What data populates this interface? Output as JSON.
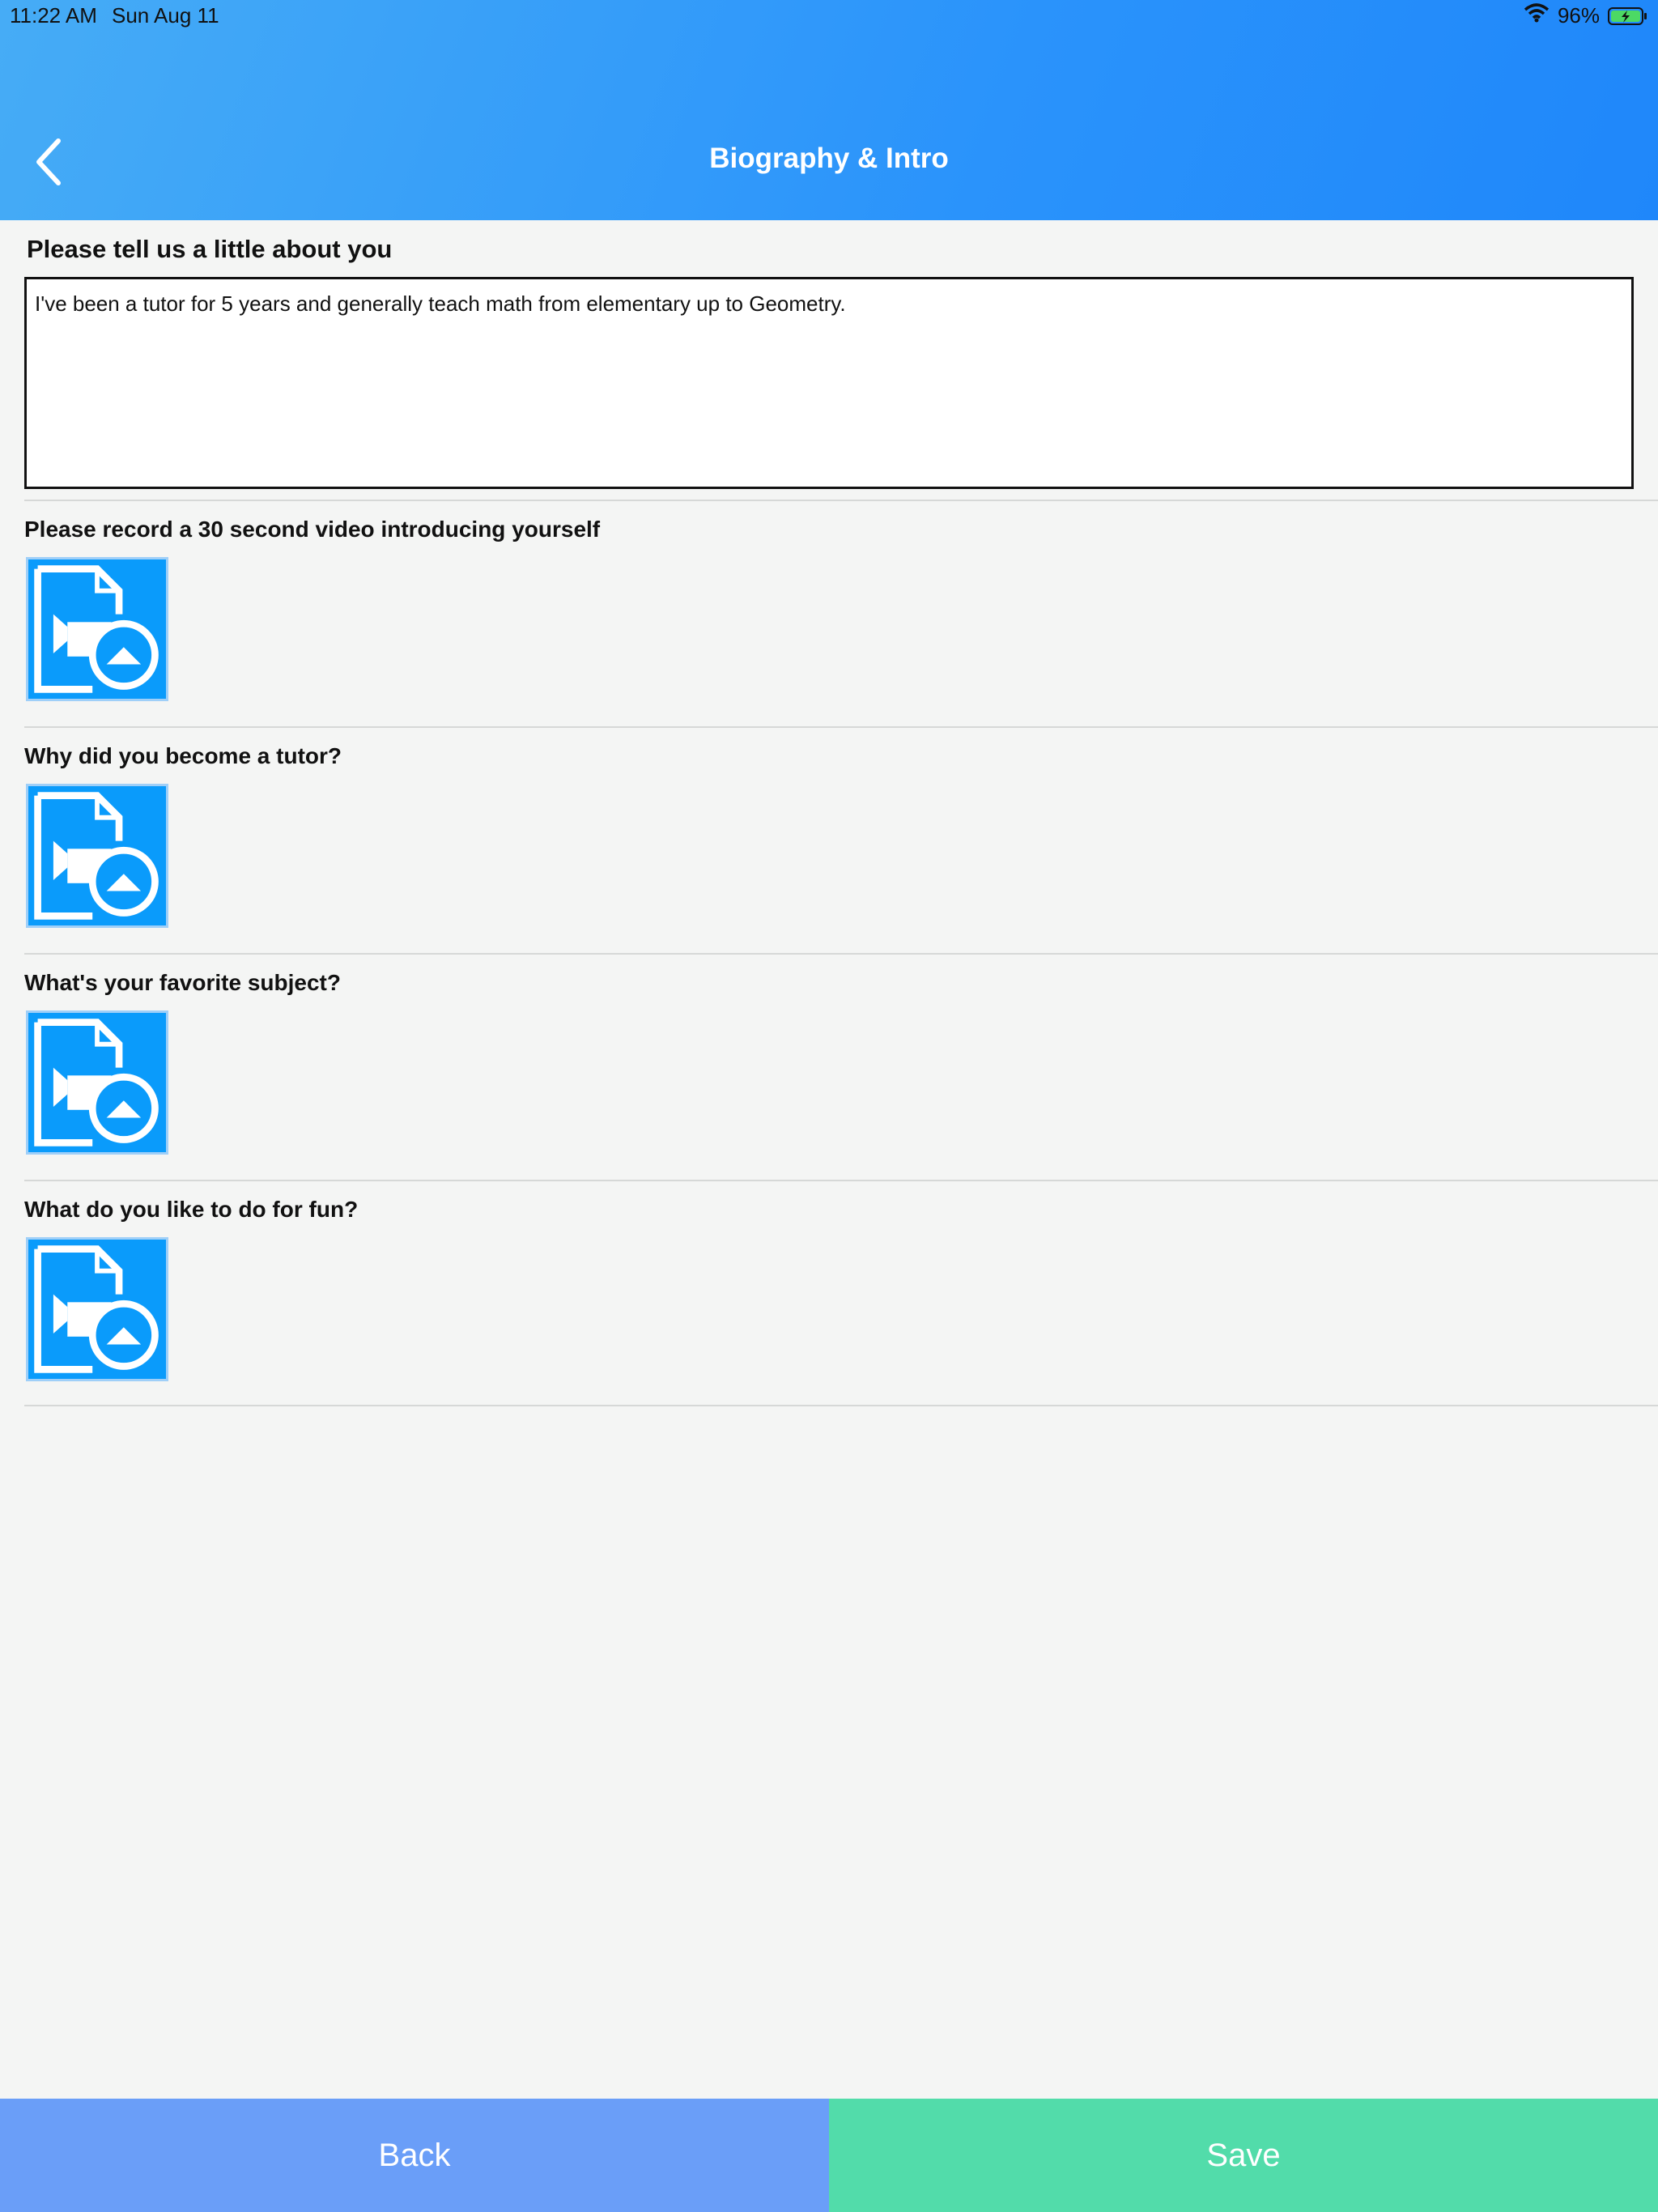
{
  "status_bar": {
    "time": "11:22 AM",
    "date": "Sun Aug 11",
    "battery_percent": "96%",
    "wifi_icon": "wifi-icon",
    "battery_icon": "battery-charging-icon"
  },
  "header": {
    "title": "Biography & Intro",
    "back_icon": "chevron-left-icon"
  },
  "bio": {
    "label": "Please tell us a little about you",
    "value": "I've been a tutor for 5 years and generally teach math from elementary up to Geometry."
  },
  "video_sections": [
    {
      "label": "Please record a 30 second video introducing yourself",
      "icon": "video-upload-icon"
    },
    {
      "label": "Why did you become a tutor?",
      "icon": "video-upload-icon"
    },
    {
      "label": "What's your favorite subject?",
      "icon": "video-upload-icon"
    },
    {
      "label": "What do you like to do for fun?",
      "icon": "video-upload-icon"
    }
  ],
  "footer": {
    "back_label": "Back",
    "save_label": "Save"
  },
  "colors": {
    "header_gradient_start": "#46acf6",
    "header_gradient_end": "#1f87fa",
    "video_button": "#0a9bfb",
    "back_button": "#6a9ef8",
    "save_button": "#52dcaa",
    "background": "#f4f5f4"
  }
}
